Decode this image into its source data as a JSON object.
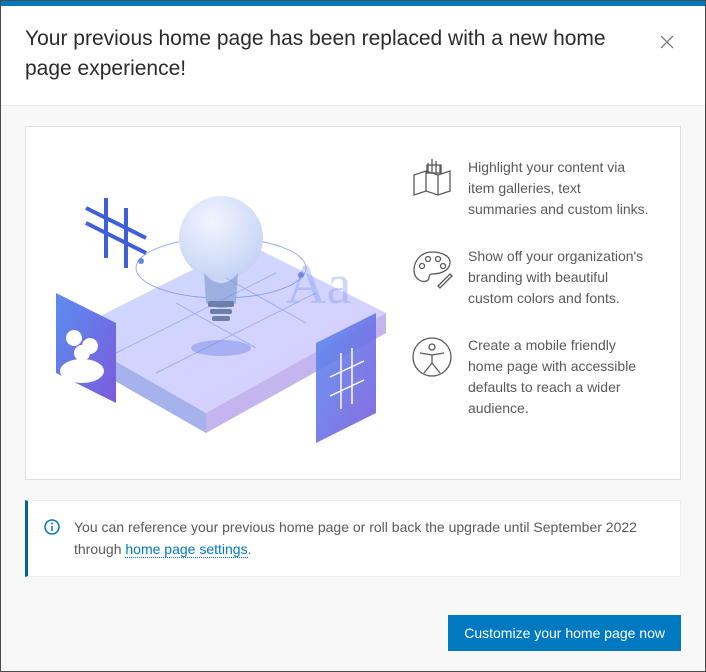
{
  "header": {
    "title": "Your previous home page has been replaced with a new home page experience!"
  },
  "features": [
    {
      "text": "Highlight your content via item galleries, text summaries and custom links."
    },
    {
      "text": "Show off your organization's branding with beautiful custom colors and fonts."
    },
    {
      "text": "Create a mobile friendly home page with accessible defaults to reach a wider audience."
    }
  ],
  "notice": {
    "text_before": "You can reference your previous home page or roll back the upgrade until September 2022 through ",
    "link_text": "home page settings",
    "text_after": "."
  },
  "footer": {
    "cta_label": "Customize your home page now"
  }
}
